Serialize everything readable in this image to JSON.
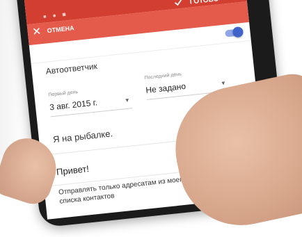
{
  "app": {
    "action_bar": {
      "cancel_label": "ОТМЕНА",
      "done_label": "ГОТОВО"
    },
    "vacation_responder": {
      "title": "Автоответчик",
      "enabled": true,
      "first_day_label": "Первый день",
      "first_day_value": "3 авг. 2015 г.",
      "last_day_label": "Последний день",
      "last_day_value": "Не задано",
      "subject": "Я на рыбалке.",
      "message": "Привет!",
      "contacts_only_label": "Отправлять только адресатам из моего списка контактов",
      "contacts_only_checked": false
    },
    "colors": {
      "status_bar": "#d23f31",
      "action_bar": "#e55b4b",
      "toggle_accent": "#3f63c9"
    },
    "icons": {
      "cancel": "close-icon",
      "done": "check-icon",
      "dropdown": "triangle-down-icon"
    }
  }
}
